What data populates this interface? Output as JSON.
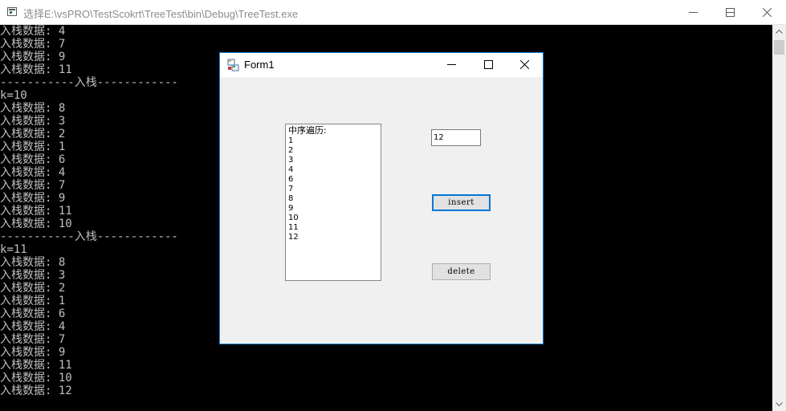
{
  "console": {
    "title": "选择E:\\vsPRO\\TestScokrt\\TreeTest\\bin\\Debug\\TreeTest.exe",
    "lines": [
      "入栈数据: 4",
      "入栈数据: 7",
      "入栈数据: 9",
      "入栈数据: 11",
      "-----------入栈------------",
      "k=10",
      "入栈数据: 8",
      "入栈数据: 3",
      "入栈数据: 2",
      "入栈数据: 1",
      "入栈数据: 6",
      "入栈数据: 4",
      "入栈数据: 7",
      "入栈数据: 9",
      "入栈数据: 11",
      "入栈数据: 10",
      "-----------入栈------------",
      "k=11",
      "入栈数据: 8",
      "入栈数据: 3",
      "入栈数据: 2",
      "入栈数据: 1",
      "入栈数据: 6",
      "入栈数据: 4",
      "入栈数据: 7",
      "入栈数据: 9",
      "入栈数据: 11",
      "入栈数据: 10",
      "入栈数据: 12"
    ],
    "scroll_position": 0.0
  },
  "form": {
    "title": "Form1",
    "listbox": {
      "header": "中序遍历:",
      "items": [
        "1",
        "2",
        "3",
        "4",
        "6",
        "7",
        "8",
        "9",
        "10",
        "11",
        "12"
      ]
    },
    "input": {
      "value": "12"
    },
    "insert_label": "insert",
    "delete_label": "delete"
  },
  "colors": {
    "console_background": "#000000",
    "console_text": "#c0c0c0",
    "form_background": "#f0f0f0",
    "focus_accent": "#0078d7"
  }
}
